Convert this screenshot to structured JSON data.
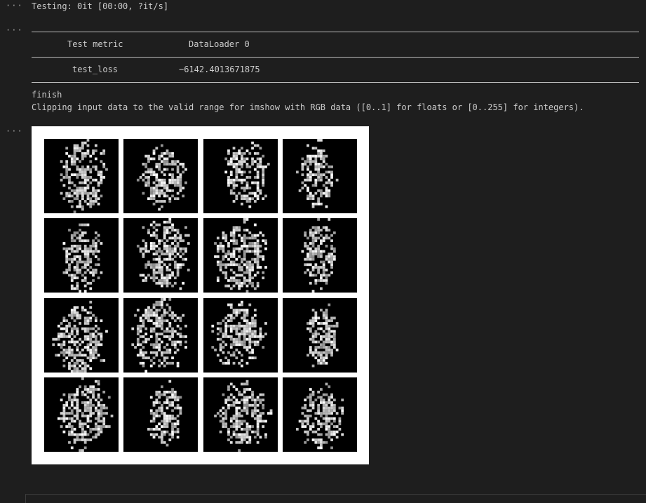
{
  "cells": {
    "dots": "···"
  },
  "output": {
    "progress_line": "Testing: 0it [00:00, ?it/s]",
    "table": {
      "headers": [
        "Test metric",
        "DataLoader 0"
      ],
      "rows": [
        [
          "test_loss",
          "−6142.4013671875"
        ]
      ]
    },
    "finish_line": "finish",
    "warning_line": "Clipping input data to the valid range for imshow with RGB data ([0..1] for floats or [0..255] for integers)."
  },
  "figure": {
    "grid_rows": 4,
    "grid_cols": 4,
    "sample_count": 16,
    "background": "#ffffff",
    "tile_background": "#000000"
  },
  "colors": {
    "editor_background": "#1e1e1e",
    "text": "#cccccc",
    "rule": "#bdbdbd"
  }
}
